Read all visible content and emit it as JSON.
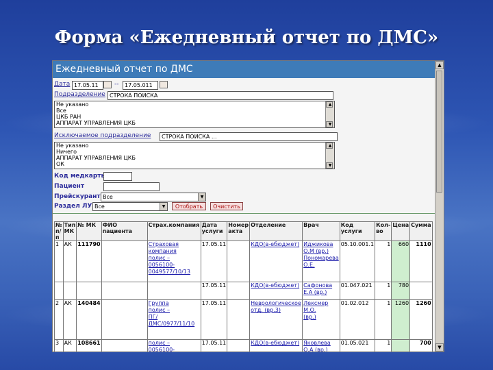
{
  "slide_title": "Форма «Ежедневный отчет по ДМС»",
  "window": {
    "header": "Ежедневный отчет по ДМС",
    "date": {
      "label": "Дата",
      "from": "17.05.11",
      "dash": "--",
      "to": "17.05.011"
    },
    "division": {
      "label": "Подразделение",
      "search": "СТРОКА ПОИСКА",
      "items": [
        "Не указано",
        "Все",
        "ЦКБ РАН",
        "АППАРАТ УПРАВЛЕНИЯ ЦКБ"
      ]
    },
    "excluded_division": {
      "label": "Исключаемое подразделение",
      "search": "СТРОКА ПОИСКА ...",
      "items": [
        "Не указано",
        "Ничего",
        "АППАРАТ УПРАВЛЕНИЯ ЦКБ",
        "ОК"
      ]
    },
    "medcard": {
      "label": "Код медкарты",
      "value": ""
    },
    "patient": {
      "label": "Пациент",
      "value": ""
    },
    "price": {
      "label": "Прейскурант",
      "value": "Все"
    },
    "section": {
      "label": "Раздел ЛУ",
      "value": "Все"
    },
    "buttons": {
      "select": "Отобрать",
      "clear": "Очистить"
    },
    "table": {
      "headers": [
        "№ п/п",
        "Тип МК",
        "№ МК",
        "ФИО пациента",
        "Страх.компания",
        "Дата услуги",
        "Номер акта",
        "Отделение",
        "Врач",
        "Код услуги",
        "Кол-во",
        "Цена",
        "Сумма"
      ],
      "rows": [
        {
          "n": "1",
          "type": "АК",
          "mk": "111790",
          "company": [
            "Страховая",
            "компания",
            "",
            "полис –",
            "0056100-",
            "0049577/10/13"
          ],
          "date": "17.05.11",
          "act": "",
          "dept": [
            "КДО(в-ебюджет)"
          ],
          "doctor": [
            "Иджикова",
            "О.М (вр.)",
            "Пономарева",
            "О.Е."
          ],
          "code": "05.10.001.1",
          "qty": "1",
          "price": "660",
          "sum": "1110"
        },
        {
          "n": "",
          "type": "",
          "mk": "",
          "company": [],
          "date": "17.05.11",
          "act": "",
          "dept": [
            "КДО(в-ебюджет)"
          ],
          "doctor": [
            "Сафонова",
            "Е.А (вр.)"
          ],
          "code": "01.047.021",
          "qty": "1",
          "price": "780",
          "sum": ""
        },
        {
          "n": "2",
          "type": "АК",
          "mk": "140484",
          "company": [
            "Группа",
            "",
            "",
            "полис –",
            "ПГ/ДМС/0977/11/10"
          ],
          "date": "17.05.11",
          "act": "",
          "dept": [
            "Неврологическое",
            "отд. (вр.3)"
          ],
          "doctor": [
            "Лексмер М.О.",
            "(вр.)"
          ],
          "code": "01.02.012",
          "qty": "1",
          "price": "1260",
          "sum": "1260"
        },
        {
          "n": "3",
          "type": "АК",
          "mk": "108661",
          "company": [
            "полис –",
            "0056100-"
          ],
          "date": "17.05.11",
          "act": "",
          "dept": [
            "КДО(в-ебюджет)"
          ],
          "doctor": [
            "Яковлева",
            "О.А (вр.)"
          ],
          "code": "01.05.021",
          "qty": "1",
          "price": "",
          "sum": "700"
        }
      ]
    }
  }
}
